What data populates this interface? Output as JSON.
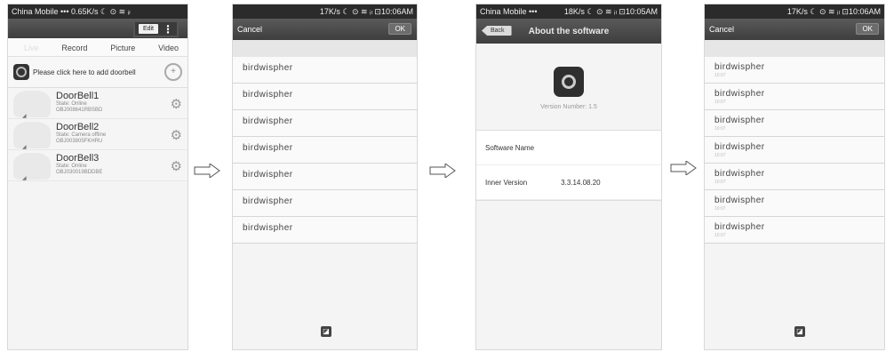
{
  "screen1": {
    "status": {
      "left": "China Mobile ••• 0.65K/s ☾ ⊙ ≋ ᵢₗ",
      "right": ""
    },
    "edit_label": "Edit",
    "tabs": [
      "Live",
      "Record",
      "Picture",
      "Video"
    ],
    "add_text": "Please click here to add doorbell",
    "bells": [
      {
        "name": "DoorBell1",
        "state": "State: Online",
        "id": "OBJ008641RBSBD"
      },
      {
        "name": "DoorBell2",
        "state": "State: Camera offline",
        "id": "OBJ003805FKHRU"
      },
      {
        "name": "DoorBell3",
        "state": "State: Online",
        "id": "OBJ030019BDDBE"
      }
    ]
  },
  "screen2": {
    "status": {
      "right": "17K/s ☾ ⊙ ≋ ᵢₗ ⊡10:06AM"
    },
    "cancel": "Cancel",
    "ok": "OK",
    "items": [
      {
        "name": "birdwispher",
        "time": ""
      },
      {
        "name": "birdwispher",
        "time": ""
      },
      {
        "name": "birdwispher",
        "time": ""
      },
      {
        "name": "birdwispher",
        "time": ""
      },
      {
        "name": "birdwispher",
        "time": ""
      },
      {
        "name": "birdwispher",
        "time": ""
      },
      {
        "name": "birdwispher",
        "time": ""
      }
    ]
  },
  "screen3": {
    "status": {
      "left": "China Mobile •••",
      "right": "18K/s ☾ ⊙ ≋ ᵢₗ ⊡10:05AM"
    },
    "back": "Back",
    "title": "About the software",
    "version_label": "Version Number: 1.5",
    "software_name_label": "Software Name",
    "inner_version_label": "Inner Version",
    "inner_version_value": "3.3.14.08.20"
  },
  "screen4": {
    "status": {
      "right": "17K/s ☾ ⊙ ≋ ᵢₗ ⊡10:06AM"
    },
    "cancel": "Cancel",
    "ok": "OK",
    "items": [
      {
        "name": "birdwispher",
        "time": "10:07"
      },
      {
        "name": "birdwispher",
        "time": "10:07"
      },
      {
        "name": "birdwispher",
        "time": "10:07"
      },
      {
        "name": "birdwispher",
        "time": "10:07"
      },
      {
        "name": "birdwispher",
        "time": "10:07"
      },
      {
        "name": "birdwispher",
        "time": "10:07"
      },
      {
        "name": "birdwispher",
        "time": "10:07"
      }
    ]
  }
}
